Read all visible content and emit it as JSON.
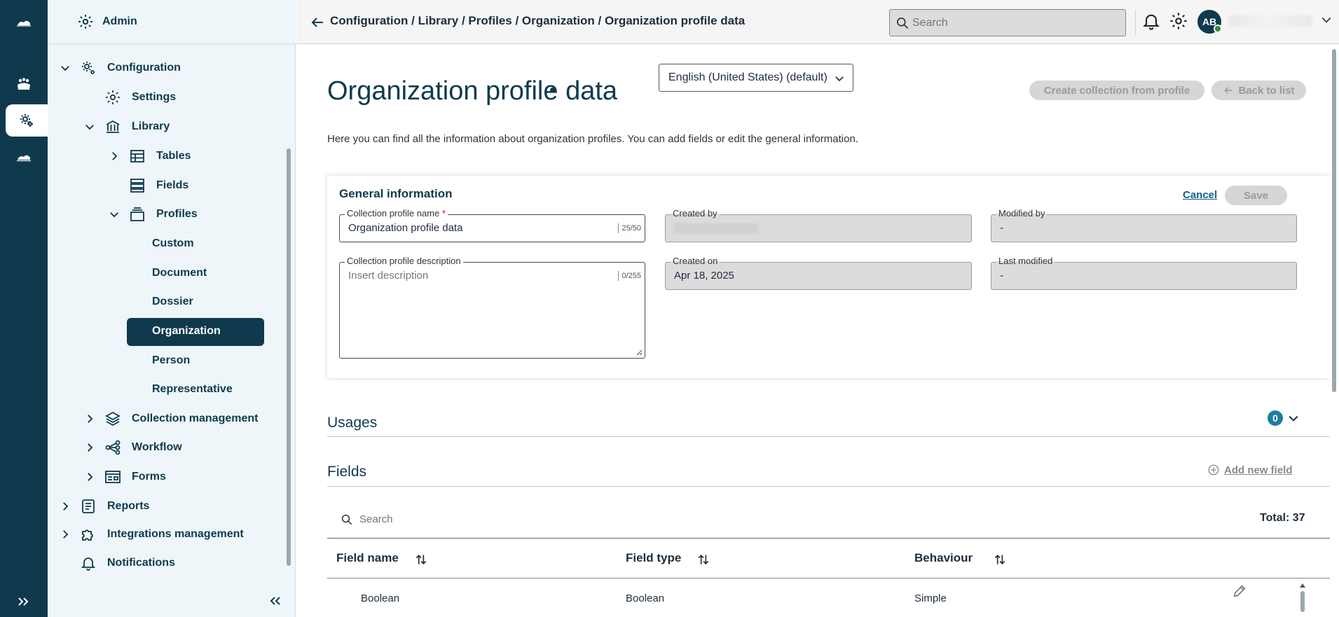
{
  "rail": {
    "items": [
      "cloud-logo-icon",
      "people-icon",
      "gear-icon",
      "cloud-icon",
      "expand-icon"
    ]
  },
  "sidebar": {
    "header": "Admin",
    "items": [
      {
        "label": "Configuration",
        "expanded": true
      },
      {
        "label": "Settings"
      },
      {
        "label": "Library",
        "expanded": true
      },
      {
        "label": "Tables",
        "expanded": false
      },
      {
        "label": "Fields"
      },
      {
        "label": "Profiles",
        "expanded": true
      },
      {
        "label": "Custom"
      },
      {
        "label": "Document"
      },
      {
        "label": "Dossier"
      },
      {
        "label": "Organization",
        "active": true
      },
      {
        "label": "Person"
      },
      {
        "label": "Representative"
      },
      {
        "label": "Collection management",
        "expanded": false
      },
      {
        "label": "Workflow",
        "expanded": false
      },
      {
        "label": "Forms",
        "expanded": false
      },
      {
        "label": "Reports",
        "expanded": false
      },
      {
        "label": "Integrations management",
        "expanded": false
      },
      {
        "label": "Notifications"
      }
    ]
  },
  "topbar": {
    "breadcrumb": "Configuration / Library / Profiles / Organization / Organization profile data",
    "search_placeholder": "Search",
    "avatar_initials": "AB"
  },
  "page": {
    "title": "Organization profile data",
    "language": "English (United States) (default)",
    "create_collection_label": "Create collection from profile",
    "back_label": "Back to list",
    "intro": "Here you can find all the information about organization profiles. You can add fields or edit the general information."
  },
  "general": {
    "title": "General information",
    "cancel_label": "Cancel",
    "save_label": "Save",
    "name_label": "Collection profile name",
    "name_value": "Organization profile data",
    "name_count": "25/50",
    "description_label": "Collection profile description",
    "description_placeholder": "Insert description",
    "description_count": "0/255",
    "created_by_label": "Created by",
    "modified_by_label": "Modified by",
    "modified_by_value": "-",
    "created_on_label": "Created on",
    "created_on_value": "Apr 18, 2025",
    "last_modified_label": "Last modified",
    "last_modified_value": "-"
  },
  "usages": {
    "title": "Usages",
    "count": "0"
  },
  "fields": {
    "title": "Fields",
    "add_label": "Add new field",
    "search_placeholder": "Search",
    "total": "Total: 37",
    "columns": [
      "Field name",
      "Field type",
      "Behaviour"
    ],
    "rows": [
      {
        "name": "Boolean",
        "type": "Boolean",
        "behaviour": "Simple"
      }
    ]
  },
  "colors": {
    "primary": "#0f3a4e",
    "sidebar_bg": "#eef6f9",
    "badge": "#1b7ea1",
    "disabled": "#d6d6d6"
  }
}
